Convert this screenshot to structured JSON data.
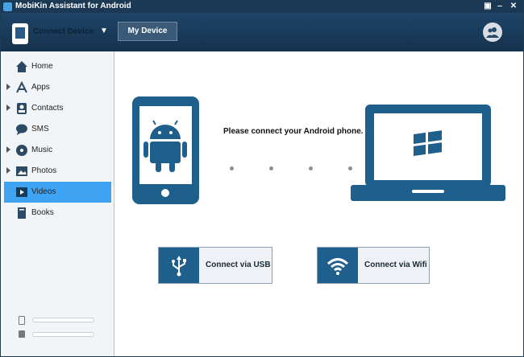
{
  "window": {
    "title": "MobiKin Assistant for Android"
  },
  "toolbar": {
    "device_selector_label": "Connect Device",
    "my_device_label": "My Device"
  },
  "sidebar": {
    "items": [
      {
        "label": "Home",
        "icon": "home-icon",
        "expandable": false
      },
      {
        "label": "Apps",
        "icon": "apps-icon",
        "expandable": true
      },
      {
        "label": "Contacts",
        "icon": "contacts-icon",
        "expandable": true
      },
      {
        "label": "SMS",
        "icon": "sms-icon",
        "expandable": false
      },
      {
        "label": "Music",
        "icon": "music-icon",
        "expandable": true
      },
      {
        "label": "Photos",
        "icon": "photos-icon",
        "expandable": true
      },
      {
        "label": "Videos",
        "icon": "videos-icon",
        "expandable": false,
        "active": true
      },
      {
        "label": "Books",
        "icon": "books-icon",
        "expandable": false
      }
    ]
  },
  "main": {
    "instruction": "Please connect your Android phone.",
    "usb_label": "Connect via USB",
    "wifi_label": "Connect via Wifi"
  },
  "colors": {
    "titlebar": "#1b3954",
    "accent": "#3fa3f4",
    "device_blue": "#1f5f8b"
  }
}
